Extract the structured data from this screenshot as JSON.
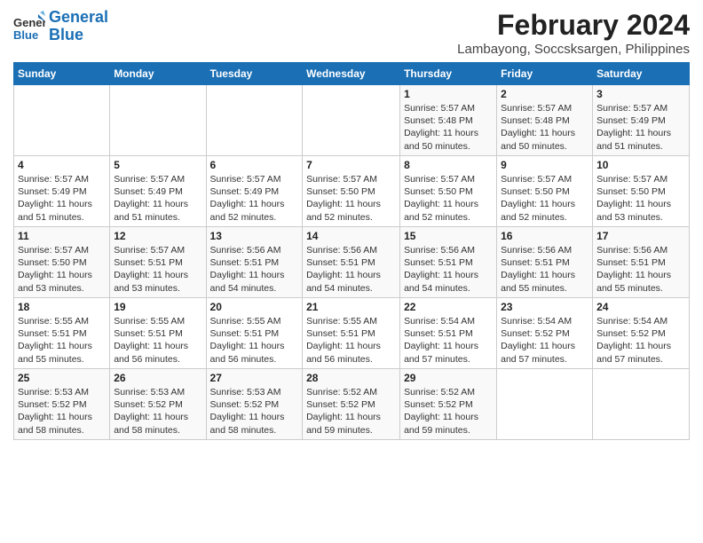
{
  "logo": {
    "line1": "General",
    "line2": "Blue"
  },
  "title": "February 2024",
  "subtitle": "Lambayong, Soccsksargen, Philippines",
  "headers": [
    "Sunday",
    "Monday",
    "Tuesday",
    "Wednesday",
    "Thursday",
    "Friday",
    "Saturday"
  ],
  "weeks": [
    [
      {
        "day": "",
        "info": ""
      },
      {
        "day": "",
        "info": ""
      },
      {
        "day": "",
        "info": ""
      },
      {
        "day": "",
        "info": ""
      },
      {
        "day": "1",
        "info": "Sunrise: 5:57 AM\nSunset: 5:48 PM\nDaylight: 11 hours and 50 minutes."
      },
      {
        "day": "2",
        "info": "Sunrise: 5:57 AM\nSunset: 5:48 PM\nDaylight: 11 hours and 50 minutes."
      },
      {
        "day": "3",
        "info": "Sunrise: 5:57 AM\nSunset: 5:49 PM\nDaylight: 11 hours and 51 minutes."
      }
    ],
    [
      {
        "day": "4",
        "info": "Sunrise: 5:57 AM\nSunset: 5:49 PM\nDaylight: 11 hours and 51 minutes."
      },
      {
        "day": "5",
        "info": "Sunrise: 5:57 AM\nSunset: 5:49 PM\nDaylight: 11 hours and 51 minutes."
      },
      {
        "day": "6",
        "info": "Sunrise: 5:57 AM\nSunset: 5:49 PM\nDaylight: 11 hours and 52 minutes."
      },
      {
        "day": "7",
        "info": "Sunrise: 5:57 AM\nSunset: 5:50 PM\nDaylight: 11 hours and 52 minutes."
      },
      {
        "day": "8",
        "info": "Sunrise: 5:57 AM\nSunset: 5:50 PM\nDaylight: 11 hours and 52 minutes."
      },
      {
        "day": "9",
        "info": "Sunrise: 5:57 AM\nSunset: 5:50 PM\nDaylight: 11 hours and 52 minutes."
      },
      {
        "day": "10",
        "info": "Sunrise: 5:57 AM\nSunset: 5:50 PM\nDaylight: 11 hours and 53 minutes."
      }
    ],
    [
      {
        "day": "11",
        "info": "Sunrise: 5:57 AM\nSunset: 5:50 PM\nDaylight: 11 hours and 53 minutes."
      },
      {
        "day": "12",
        "info": "Sunrise: 5:57 AM\nSunset: 5:51 PM\nDaylight: 11 hours and 53 minutes."
      },
      {
        "day": "13",
        "info": "Sunrise: 5:56 AM\nSunset: 5:51 PM\nDaylight: 11 hours and 54 minutes."
      },
      {
        "day": "14",
        "info": "Sunrise: 5:56 AM\nSunset: 5:51 PM\nDaylight: 11 hours and 54 minutes."
      },
      {
        "day": "15",
        "info": "Sunrise: 5:56 AM\nSunset: 5:51 PM\nDaylight: 11 hours and 54 minutes."
      },
      {
        "day": "16",
        "info": "Sunrise: 5:56 AM\nSunset: 5:51 PM\nDaylight: 11 hours and 55 minutes."
      },
      {
        "day": "17",
        "info": "Sunrise: 5:56 AM\nSunset: 5:51 PM\nDaylight: 11 hours and 55 minutes."
      }
    ],
    [
      {
        "day": "18",
        "info": "Sunrise: 5:55 AM\nSunset: 5:51 PM\nDaylight: 11 hours and 55 minutes."
      },
      {
        "day": "19",
        "info": "Sunrise: 5:55 AM\nSunset: 5:51 PM\nDaylight: 11 hours and 56 minutes."
      },
      {
        "day": "20",
        "info": "Sunrise: 5:55 AM\nSunset: 5:51 PM\nDaylight: 11 hours and 56 minutes."
      },
      {
        "day": "21",
        "info": "Sunrise: 5:55 AM\nSunset: 5:51 PM\nDaylight: 11 hours and 56 minutes."
      },
      {
        "day": "22",
        "info": "Sunrise: 5:54 AM\nSunset: 5:51 PM\nDaylight: 11 hours and 57 minutes."
      },
      {
        "day": "23",
        "info": "Sunrise: 5:54 AM\nSunset: 5:52 PM\nDaylight: 11 hours and 57 minutes."
      },
      {
        "day": "24",
        "info": "Sunrise: 5:54 AM\nSunset: 5:52 PM\nDaylight: 11 hours and 57 minutes."
      }
    ],
    [
      {
        "day": "25",
        "info": "Sunrise: 5:53 AM\nSunset: 5:52 PM\nDaylight: 11 hours and 58 minutes."
      },
      {
        "day": "26",
        "info": "Sunrise: 5:53 AM\nSunset: 5:52 PM\nDaylight: 11 hours and 58 minutes."
      },
      {
        "day": "27",
        "info": "Sunrise: 5:53 AM\nSunset: 5:52 PM\nDaylight: 11 hours and 58 minutes."
      },
      {
        "day": "28",
        "info": "Sunrise: 5:52 AM\nSunset: 5:52 PM\nDaylight: 11 hours and 59 minutes."
      },
      {
        "day": "29",
        "info": "Sunrise: 5:52 AM\nSunset: 5:52 PM\nDaylight: 11 hours and 59 minutes."
      },
      {
        "day": "",
        "info": ""
      },
      {
        "day": "",
        "info": ""
      }
    ]
  ]
}
